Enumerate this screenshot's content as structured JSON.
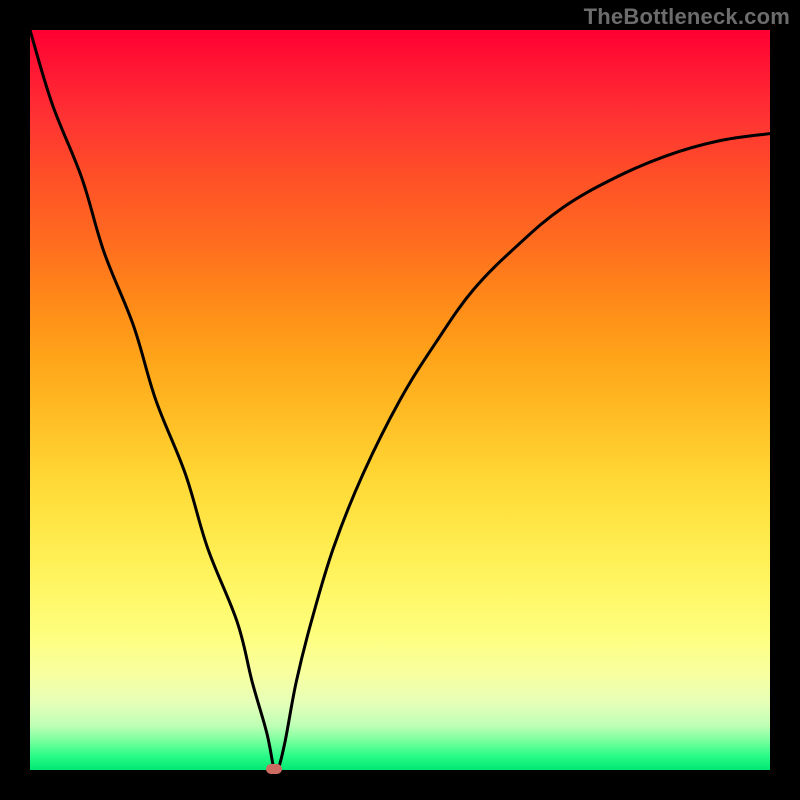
{
  "watermark": "TheBottleneck.com",
  "colors": {
    "curve": "#000000",
    "dot": "#cc6b62",
    "frame": "#000000"
  },
  "chart_data": {
    "type": "line",
    "title": "",
    "xlabel": "",
    "ylabel": "",
    "xlim": [
      0,
      1
    ],
    "ylim": [
      0,
      1
    ],
    "annotations": [
      "TheBottleneck.com"
    ],
    "background": "vertical gradient red→yellow→green (heatmap)",
    "minimum_point": {
      "x": 0.33,
      "y": 0.0
    },
    "series": [
      {
        "name": "bottleneck-curve",
        "x": [
          0.0,
          0.03,
          0.07,
          0.1,
          0.14,
          0.17,
          0.21,
          0.24,
          0.28,
          0.3,
          0.32,
          0.33,
          0.335,
          0.345,
          0.36,
          0.38,
          0.41,
          0.45,
          0.5,
          0.55,
          0.6,
          0.66,
          0.72,
          0.79,
          0.86,
          0.93,
          1.0
        ],
        "y": [
          1.0,
          0.9,
          0.8,
          0.7,
          0.6,
          0.5,
          0.4,
          0.3,
          0.2,
          0.12,
          0.05,
          0.0,
          0.0,
          0.04,
          0.12,
          0.2,
          0.3,
          0.4,
          0.5,
          0.58,
          0.65,
          0.71,
          0.76,
          0.8,
          0.83,
          0.85,
          0.86
        ]
      }
    ]
  }
}
